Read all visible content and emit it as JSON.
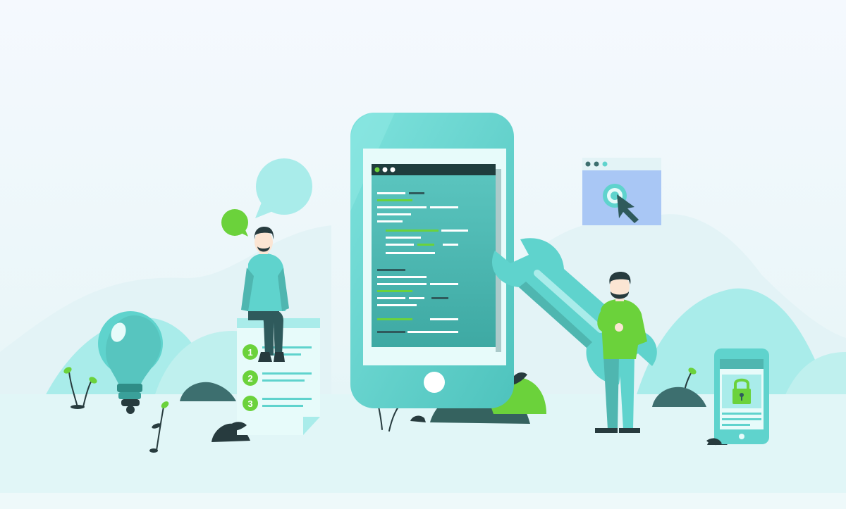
{
  "illustration": {
    "subject": "app-development-team",
    "checklist_numbers": [
      "1",
      "2",
      "3"
    ],
    "window_dots": 3,
    "icons": [
      "lightbulb-icon",
      "speech-bubble-icon",
      "wrench-icon",
      "cursor-icon",
      "lock-icon",
      "home-button-icon"
    ]
  },
  "colors": {
    "background_top": "#f3f8fd",
    "background_bottom": "#dff4f5",
    "teal_light": "#a9ecea",
    "teal": "#5fd3cd",
    "teal_mid": "#4fb6b0",
    "teal_dark": "#2f8d87",
    "slate": "#2f5a5c",
    "green": "#6bd23b",
    "skin": "#fbe5d3",
    "dark": "#273b3e",
    "browser_blue": "#a9c7f5"
  }
}
